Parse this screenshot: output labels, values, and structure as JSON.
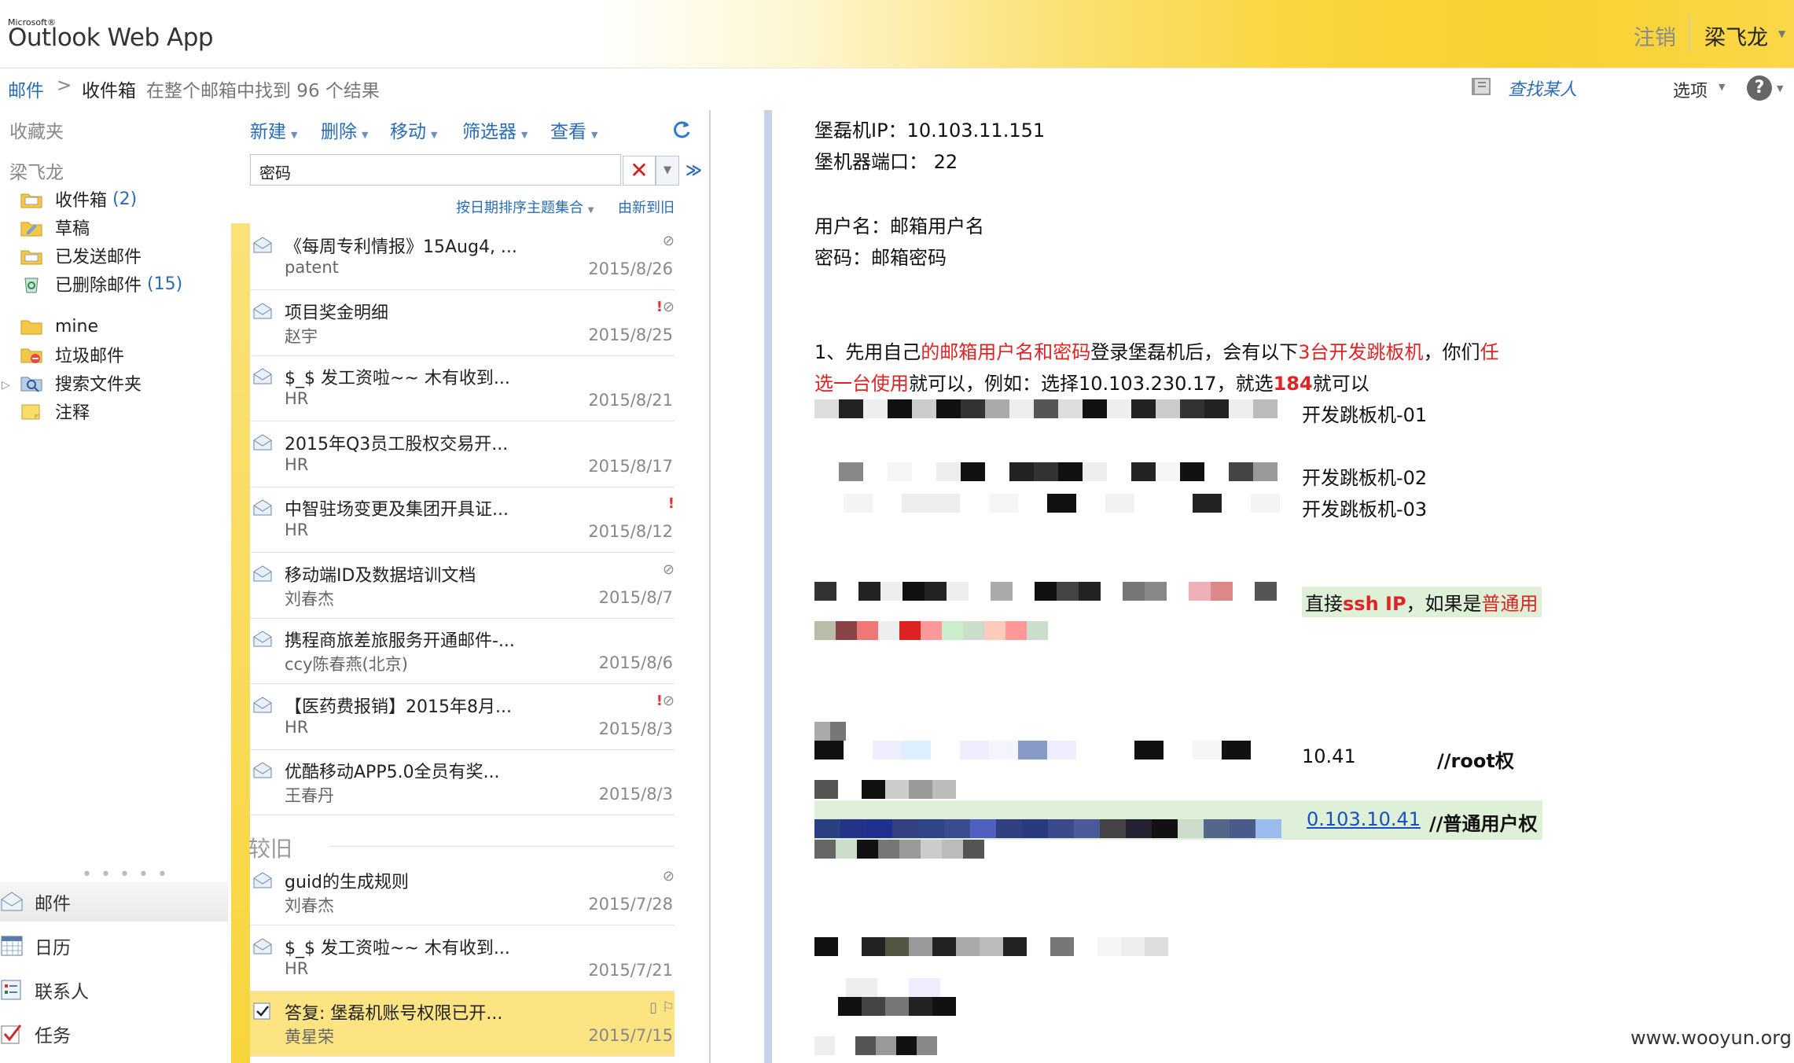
{
  "app": {
    "brand_small": "Microsoft®",
    "title": "Outlook Web App",
    "signout": "注销",
    "user": "梁飞龙"
  },
  "breadcrumb": {
    "mail": "邮件",
    "sep": ">",
    "folder": "收件箱",
    "result": "在整个邮箱中找到 96 个结果"
  },
  "topbar": {
    "find_people": "查找某人",
    "options": "选项",
    "help": "?"
  },
  "sidebar": {
    "favorites": "收藏夹",
    "account": "梁飞龙",
    "folders": [
      {
        "label": "收件箱",
        "count": "(2)"
      },
      {
        "label": "草稿",
        "count": ""
      },
      {
        "label": "已发送邮件",
        "count": ""
      },
      {
        "label": "已删除邮件",
        "count": "(15)"
      },
      {
        "label": "mine",
        "count": ""
      },
      {
        "label": "垃圾邮件",
        "count": ""
      },
      {
        "label": "搜索文件夹",
        "count": ""
      },
      {
        "label": "注释",
        "count": ""
      }
    ],
    "dots": "• • • • •",
    "nav": {
      "mail": "邮件",
      "calendar": "日历",
      "contacts": "联系人",
      "tasks": "任务"
    }
  },
  "toolbar": {
    "new": "新建",
    "delete": "删除",
    "move": "移动",
    "filter": "筛选器",
    "view": "查看"
  },
  "search": {
    "value": "密码"
  },
  "sort": {
    "by": "按日期排序主题集合",
    "order": "由新到旧"
  },
  "messages": [
    {
      "subject": "《每周专利情报》15Aug4, ...",
      "from": "patent",
      "date": "2015/8/26",
      "important": false,
      "attach": true
    },
    {
      "subject": "项目奖金明细",
      "from": "赵宇",
      "date": "2015/8/25",
      "important": true,
      "attach": true
    },
    {
      "subject": "$_$ 发工资啦~~ 木有收到...",
      "from": "HR",
      "date": "2015/8/21",
      "important": false,
      "attach": false
    },
    {
      "subject": "2015年Q3员工股权交易开...",
      "from": "HR",
      "date": "2015/8/17",
      "important": false,
      "attach": false
    },
    {
      "subject": "中智驻场变更及集团开具证...",
      "from": "HR",
      "date": "2015/8/12",
      "important": true,
      "attach": false
    },
    {
      "subject": "移动端ID及数据培训文档",
      "from": "刘春杰",
      "date": "2015/8/7",
      "important": false,
      "attach": true
    },
    {
      "subject": "携程商旅差旅服务开通邮件-...",
      "from": "ccy陈春燕(北京)",
      "date": "2015/8/6",
      "important": false,
      "attach": false
    },
    {
      "subject": "【医药费报销】2015年8月...",
      "from": "HR",
      "date": "2015/8/3",
      "important": true,
      "attach": true
    },
    {
      "subject": "优酷移动APP5.0全员有奖...",
      "from": "王春丹",
      "date": "2015/8/3",
      "important": false,
      "attach": false
    }
  ],
  "older_label": "较旧",
  "older_messages": [
    {
      "subject": "guid的生成规则",
      "from": "刘春杰",
      "date": "2015/7/28",
      "important": false,
      "attach": true
    },
    {
      "subject": "$_$ 发工资啦~~ 木有收到...",
      "from": "HR",
      "date": "2015/7/21",
      "important": false,
      "attach": false
    },
    {
      "subject": "答复: 堡磊机账号权限已开...",
      "from": "黄星荣",
      "date": "2015/7/15",
      "important": false,
      "attach": false,
      "selected": true
    }
  ],
  "reading": {
    "line1": "堡磊机IP：10.103.11.151",
    "line2": "堡机器端口： 22",
    "line3": "用户名：邮箱用户名",
    "line4": "密码：邮箱密码",
    "p1a": "1、先用自己",
    "p1b": "的邮箱用户名和密码",
    "p1c": "登录堡磊机后，会有以下",
    "p1d": "3台开发跳板机",
    "p1e": "，你们",
    "p1f": "任",
    "p2a": "选一台使用",
    "p2b": "就可以，例如：选择10.103.230.17，就选",
    "p2c": "184",
    "p2d": "就可以",
    "jump1": "开发跳板机-01",
    "jump2": "开发跳板机-02",
    "jump3": "开发跳板机-03",
    "ssh_a": "直接",
    "ssh_b": "ssh IP",
    "ssh_c": "，如果是",
    "ssh_d": "普通用",
    "ip_a": "10.41",
    "root": "//root权",
    "ip_b": "0.103.10.41",
    "normal": "//普通用户权"
  },
  "watermark": "www.wooyun.org"
}
